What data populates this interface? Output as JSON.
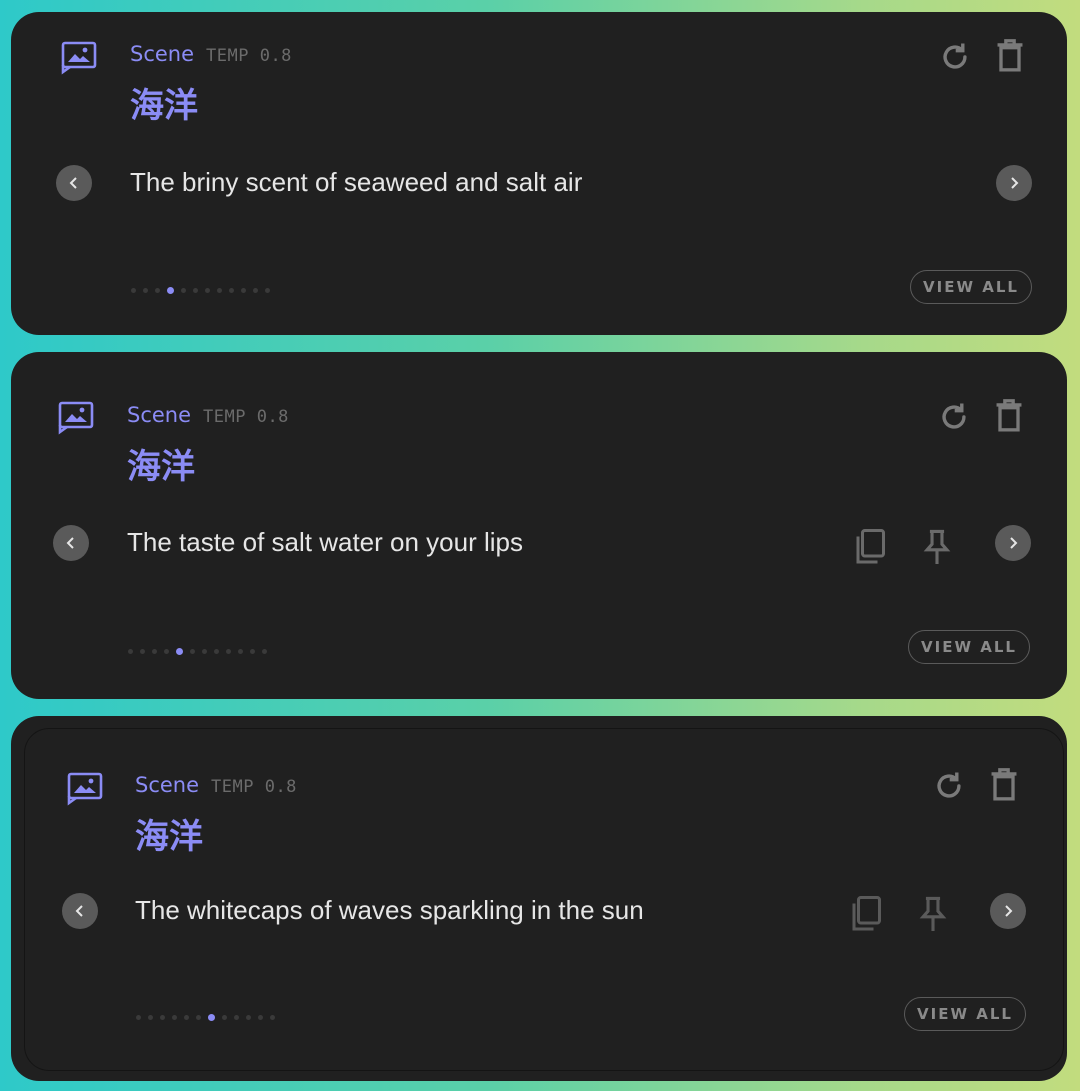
{
  "colors": {
    "accent": "#8b8cf5",
    "card_bg": "#202020",
    "icon_gray": "#7a7a7a",
    "text": "#e6e6e6"
  },
  "cards": [
    {
      "scene_label": "Scene",
      "temp_label": "TEMP 0.8",
      "title": "海洋",
      "text": "The briny scent of seaweed and salt air",
      "view_all_label": "VIEW ALL",
      "page_count": 12,
      "active_page": 4,
      "show_copy": false,
      "show_pin": false
    },
    {
      "scene_label": "Scene",
      "temp_label": "TEMP 0.8",
      "title": "海洋",
      "text": "The taste of salt water on your lips",
      "view_all_label": "VIEW ALL",
      "page_count": 12,
      "active_page": 5,
      "show_copy": true,
      "show_pin": true
    },
    {
      "scene_label": "Scene",
      "temp_label": "TEMP 0.8",
      "title": "海洋",
      "text": "The whitecaps of waves sparkling in the sun",
      "view_all_label": "VIEW ALL",
      "page_count": 12,
      "active_page": 7,
      "show_copy": true,
      "show_pin": true
    }
  ],
  "icons": {
    "scene": "image-icon",
    "refresh": "refresh-icon",
    "delete": "trash-icon",
    "prev": "chevron-left-icon",
    "next": "chevron-right-icon",
    "copy": "copy-icon",
    "pin": "pin-icon"
  }
}
